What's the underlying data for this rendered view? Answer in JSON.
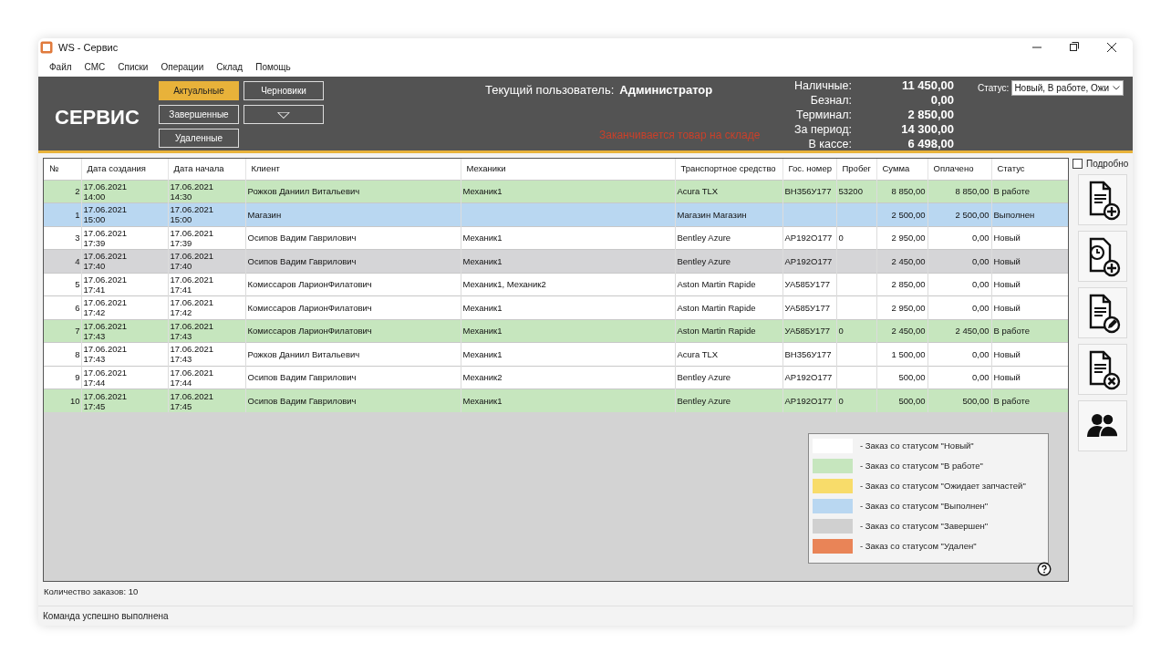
{
  "window": {
    "title": "WS - Сервис"
  },
  "menu": [
    "Файл",
    "СМС",
    "Списки",
    "Операции",
    "Склад",
    "Помощь"
  ],
  "header": {
    "logo": "СЕРВИС",
    "filters": [
      {
        "label": "Актуальные",
        "selected": true
      },
      {
        "label": "Черновики",
        "selected": false
      },
      {
        "label": "Завершенные",
        "selected": false
      },
      {
        "label": "▽",
        "kind": "dropdown",
        "selected": false
      },
      {
        "label": "Удаленные",
        "selected": false
      }
    ],
    "user_label": "Текущий пользователь:",
    "user": "Администратор",
    "warning": "Заканчивается товар на складе",
    "totals": [
      {
        "label": "Наличные:",
        "value": "11 450,00"
      },
      {
        "label": "Безнал:",
        "value": "0,00"
      },
      {
        "label": "Терминал:",
        "value": "2 850,00"
      },
      {
        "label": "За период:",
        "value": "14 300,00"
      },
      {
        "label": "В кассе:",
        "value": "6 498,00"
      }
    ],
    "status_filter": {
      "label": "Статус:",
      "value": "Новый, В работе, Ожи"
    }
  },
  "table": {
    "columns": [
      "№",
      "Дата создания",
      "Дата начала",
      "Клиент",
      "Механики",
      "Транспортное средство",
      "Гос. номер",
      "Пробег",
      "Сумма",
      "Оплачено",
      "Статус"
    ],
    "rows": [
      {
        "color": "#c6e6be",
        "cells": [
          "2",
          "17.06.2021\n14:00",
          "17.06.2021\n14:30",
          "Рожков Даниил Витальевич",
          "Механик1",
          "Acura TLX",
          "ВН356У177",
          "53200",
          "8 850,00",
          "8 850,00",
          "В работе"
        ]
      },
      {
        "color": "#b9d7f1",
        "cells": [
          "1",
          "17.06.2021\n15:00",
          "17.06.2021\n15:00",
          "Магазин",
          "",
          "Магазин Магазин",
          "",
          "",
          "2 500,00",
          "2 500,00",
          "Выполнен"
        ]
      },
      {
        "color": "#ffffff",
        "cells": [
          "3",
          "17.06.2021\n17:39",
          "17.06.2021\n17:39",
          "Осипов Вадим Гаврилович",
          "Механик1",
          "Bentley Azure",
          "АР192О177",
          "0",
          "2 950,00",
          "0,00",
          "Новый"
        ]
      },
      {
        "color": "#d5d5d7",
        "cells": [
          "4",
          "17.06.2021\n17:40",
          "17.06.2021\n17:40",
          "Осипов Вадим Гаврилович",
          "Механик1",
          "Bentley Azure",
          "АР192О177",
          "",
          "2 450,00",
          "0,00",
          "Новый"
        ]
      },
      {
        "color": "#ffffff",
        "cells": [
          "5",
          "17.06.2021\n17:41",
          "17.06.2021\n17:41",
          "Комиссаров ЛарионФилатович",
          "Механик1, Механик2",
          "Aston Martin Rapide",
          "УА585У177",
          "",
          "2 850,00",
          "0,00",
          "Новый"
        ]
      },
      {
        "color": "#ffffff",
        "cells": [
          "6",
          "17.06.2021\n17:42",
          "17.06.2021\n17:42",
          "Комиссаров ЛарионФилатович",
          "Механик1",
          "Aston Martin Rapide",
          "УА585У177",
          "",
          "2 950,00",
          "0,00",
          "Новый"
        ]
      },
      {
        "color": "#c6e6be",
        "cells": [
          "7",
          "17.06.2021\n17:43",
          "17.06.2021\n17:43",
          "Комиссаров ЛарионФилатович",
          "Механик1",
          "Aston Martin Rapide",
          "УА585У177",
          "0",
          "2 450,00",
          "2 450,00",
          "В работе"
        ]
      },
      {
        "color": "#ffffff",
        "cells": [
          "8",
          "17.06.2021\n17:43",
          "17.06.2021\n17:43",
          "Рожков Даниил Витальевич",
          "Механик1",
          "Acura TLX",
          "ВН356У177",
          "",
          "1 500,00",
          "0,00",
          "Новый"
        ]
      },
      {
        "color": "#ffffff",
        "cells": [
          "9",
          "17.06.2021\n17:44",
          "17.06.2021\n17:44",
          "Осипов Вадим Гаврилович",
          "Механик2",
          "Bentley Azure",
          "АР192О177",
          "",
          "500,00",
          "0,00",
          "Новый"
        ]
      },
      {
        "color": "#c6e6be",
        "cells": [
          "10",
          "17.06.2021\n17:45",
          "17.06.2021\n17:45",
          "Осипов Вадим Гаврилович",
          "Механик1",
          "Bentley Azure",
          "АР192О177",
          "0",
          "500,00",
          "500,00",
          "В работе"
        ]
      }
    ]
  },
  "legend": [
    {
      "color": "#ffffff",
      "label": "- Заказ со статусом \"Новый\""
    },
    {
      "color": "#c6e6be",
      "label": "- Заказ со статусом \"В работе\""
    },
    {
      "color": "#f8dc6a",
      "label": "- Заказ со статусом \"Ожидает запчастей\""
    },
    {
      "color": "#b9d7f1",
      "label": "- Заказ со статусом \"Выполнен\""
    },
    {
      "color": "#d0d0d0",
      "label": "- Заказ со статусом \"Завершен\""
    },
    {
      "color": "#e98457",
      "label": "- Заказ со статусом \"Удален\""
    }
  ],
  "detail_checkbox": {
    "label": "Подробно",
    "checked": false
  },
  "side_buttons": [
    {
      "kind": "new"
    },
    {
      "kind": "scheduled"
    },
    {
      "kind": "edit"
    },
    {
      "kind": "delete"
    },
    {
      "kind": "people"
    }
  ],
  "order_count": "Количество заказов: 10",
  "status_bar": "Команда успешно выполнена"
}
